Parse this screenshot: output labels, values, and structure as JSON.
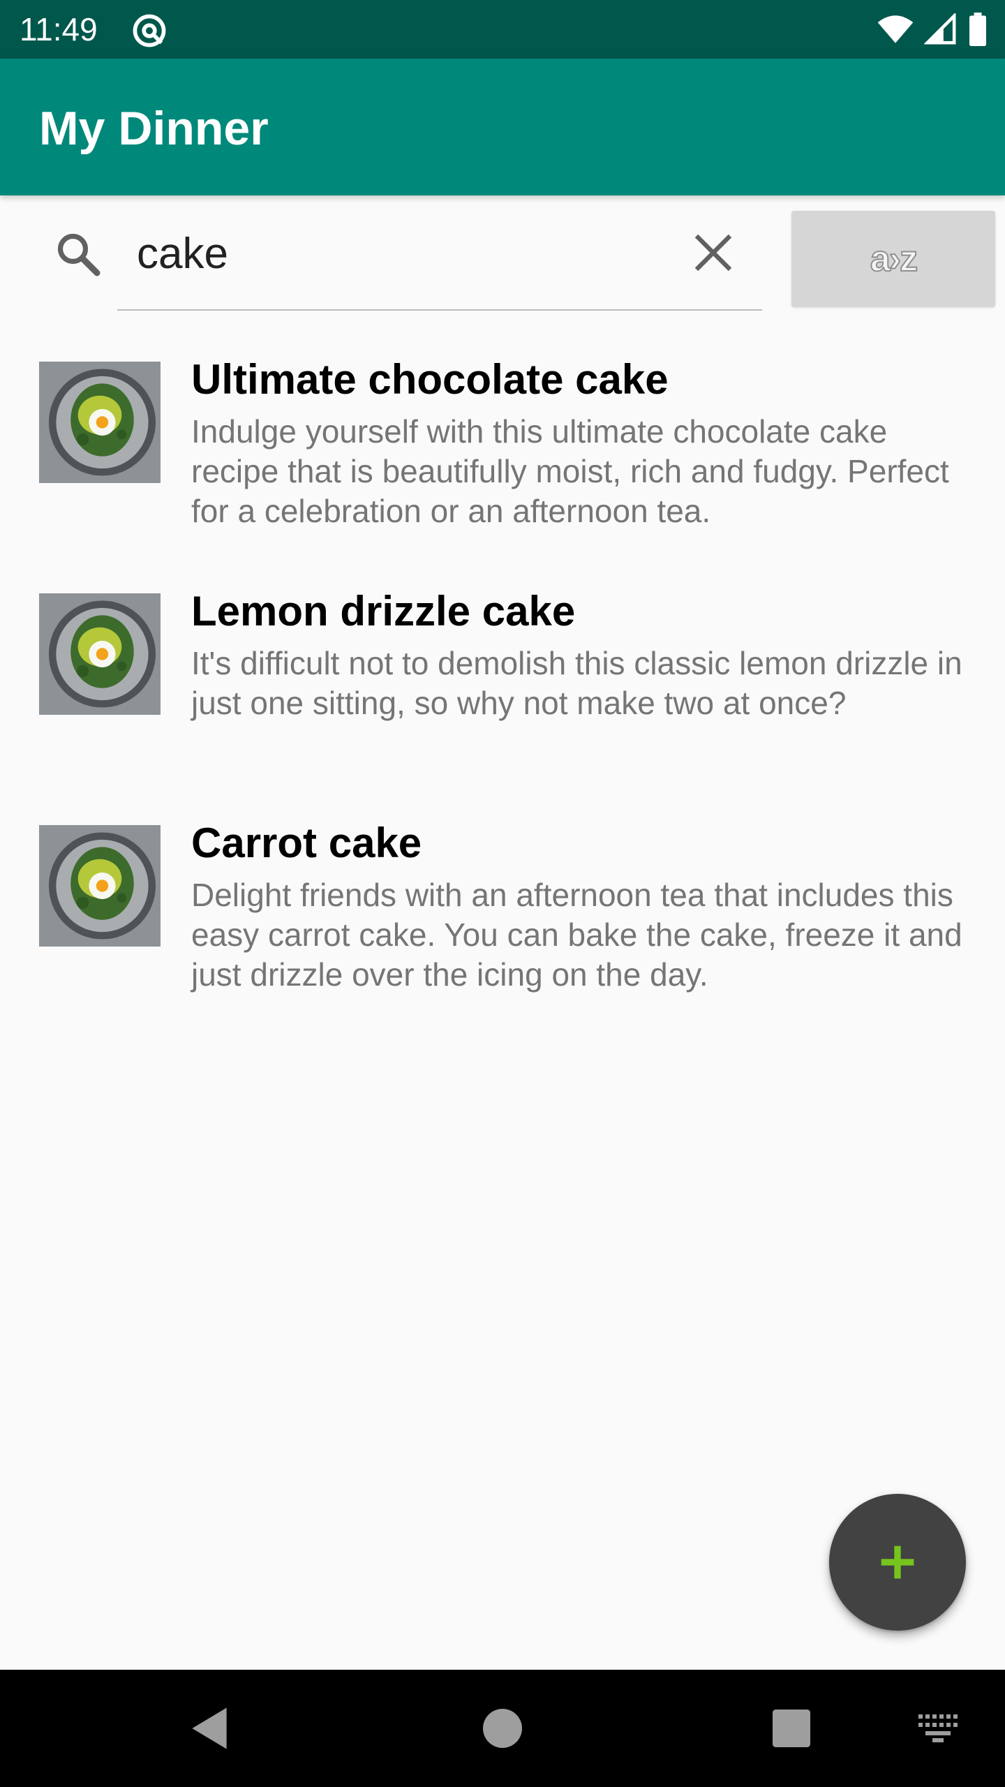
{
  "status_bar": {
    "time": "11:49",
    "app_icon": "at-sign-icon",
    "icons": [
      "wifi-icon",
      "signal-icon",
      "battery-icon"
    ]
  },
  "app_bar": {
    "title": "My Dinner",
    "color": "#00897b"
  },
  "search": {
    "value": "cake",
    "icon": "search-icon",
    "clear_icon": "close-icon"
  },
  "sort_button": {
    "label": "a›z",
    "icon": "sort-az-icon"
  },
  "recipes": [
    {
      "title": "Ultimate chocolate cake",
      "description": "Indulge yourself with this ultimate chocolate cake recipe that is beautifully moist, rich and fudgy. Perfect for a celebration or an afternoon tea.",
      "thumbnail": "avocado-toast-egg-photo"
    },
    {
      "title": "Lemon drizzle cake",
      "description": "It's difficult not to demolish this classic lemon drizzle in just one sitting, so why not make two at once?",
      "thumbnail": "avocado-toast-egg-photo"
    },
    {
      "title": "Carrot cake",
      "description": "Delight friends with an afternoon tea that includes this easy carrot cake. You can bake the cake, freeze it and just drizzle over the icing on the day.",
      "thumbnail": "avocado-toast-egg-photo"
    }
  ],
  "fab": {
    "icon": "plus-icon",
    "color": "#424242",
    "icon_color": "#76c41e"
  },
  "nav_bar": {
    "icons": [
      "back-icon",
      "home-icon",
      "recents-icon",
      "keyboard-icon"
    ]
  }
}
